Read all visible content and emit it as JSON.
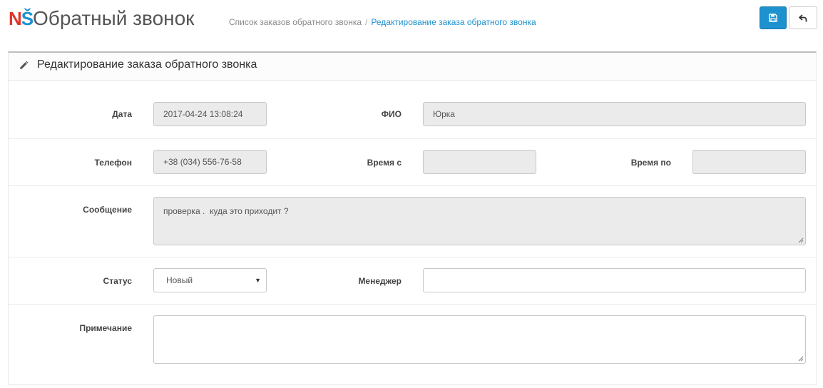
{
  "header": {
    "logo_n": "N",
    "logo_s": "Š",
    "title": "Обратный звонок",
    "breadcrumb": [
      "Список заказов обратного звонка",
      "Редактирование заказа обратного звонка"
    ],
    "breadcrumb_sep": "/",
    "save_icon": "save-icon",
    "back_icon": "back-arrow-icon"
  },
  "panel": {
    "title": "Редактирование заказа обратного звонка",
    "icon": "pencil-icon"
  },
  "form": {
    "date_label": "Дата",
    "date_value": "2017-04-24 13:08:24",
    "fio_label": "ФИО",
    "fio_value": "Юрка",
    "phone_label": "Телефон",
    "phone_value": "+38 (034) 556-76-58",
    "time_from_label": "Время с",
    "time_from_value": "",
    "time_to_label": "Время по",
    "time_to_value": "",
    "message_label": "Сообщение",
    "message_value": "проверка .  куда это приходит ?",
    "status_label": "Статус",
    "status_value": "Новый",
    "manager_label": "Менеджер",
    "manager_value": "",
    "note_label": "Примечание",
    "note_value": ""
  },
  "colors": {
    "primary": "#1e91cf",
    "logo_red": "#e0352b",
    "readonly_bg": "#ebebeb"
  }
}
